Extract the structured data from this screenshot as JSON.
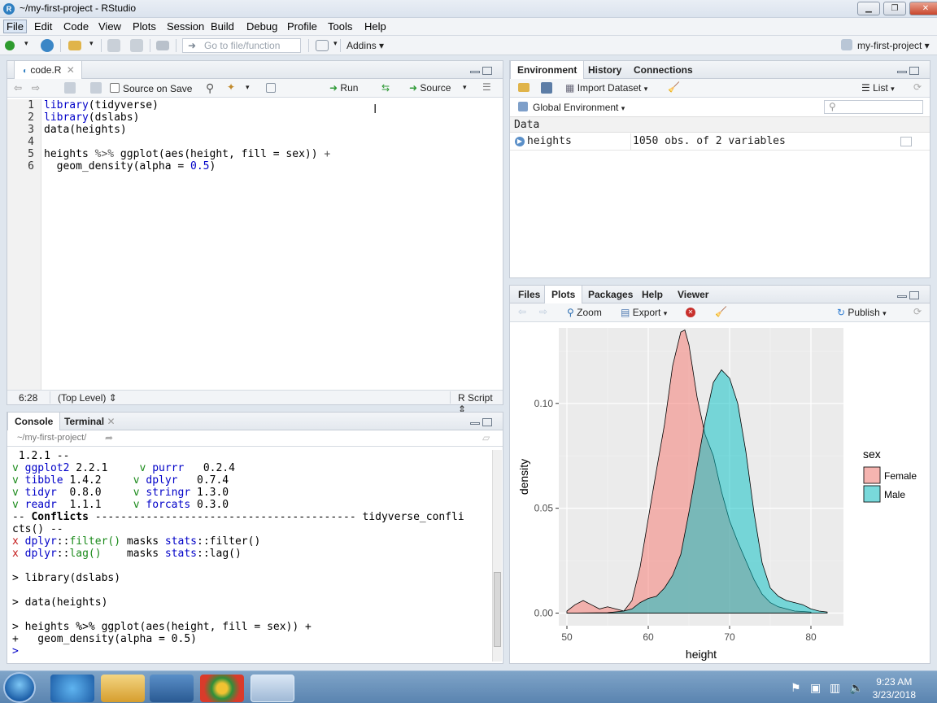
{
  "window": {
    "title": "~/my-first-project - RStudio"
  },
  "menu": [
    "File",
    "Edit",
    "Code",
    "View",
    "Plots",
    "Session",
    "Build",
    "Debug",
    "Profile",
    "Tools",
    "Help"
  ],
  "toolbar": {
    "goto_placeholder": "Go to file/function",
    "addins": "Addins",
    "project": "my-first-project"
  },
  "editor": {
    "tab": "code.R",
    "source_on_save": "Source on Save",
    "run": "Run",
    "source": "Source",
    "lines": [
      {
        "num": "1",
        "parts": [
          [
            "kw",
            "library"
          ],
          [
            "",
            "(tidyverse)"
          ]
        ]
      },
      {
        "num": "2",
        "parts": [
          [
            "kw",
            "library"
          ],
          [
            "",
            "(dslabs)"
          ]
        ]
      },
      {
        "num": "3",
        "parts": [
          [
            "",
            "data(heights)"
          ]
        ]
      },
      {
        "num": "4",
        "parts": [
          [
            "",
            ""
          ]
        ]
      },
      {
        "num": "5",
        "parts": [
          [
            "",
            "heights "
          ],
          [
            "op",
            "%>%"
          ],
          [
            "",
            " ggplot(aes(height, fill = sex)) "
          ],
          [
            "op",
            "+"
          ]
        ]
      },
      {
        "num": "6",
        "parts": [
          [
            "",
            "  geom_density(alpha = "
          ],
          [
            "num",
            "0.5"
          ],
          [
            "",
            ")"
          ]
        ]
      }
    ],
    "status_pos": "6:28",
    "status_scope": "(Top Level)",
    "status_type": "R Script"
  },
  "console": {
    "tabs": [
      "Console",
      "Terminal"
    ],
    "path": "~/my-first-project/",
    "lines": [
      [
        [
          "",
          " 1.2.1 --"
        ]
      ],
      [
        [
          "grn",
          "v "
        ],
        [
          "blu",
          "ggplot2"
        ],
        [
          "",
          " 2.2.1     "
        ],
        [
          "grn",
          "v "
        ],
        [
          "blu",
          "purrr"
        ],
        [
          "",
          "   0.2.4"
        ]
      ],
      [
        [
          "grn",
          "v "
        ],
        [
          "blu",
          "tibble"
        ],
        [
          "",
          " 1.4.2     "
        ],
        [
          "grn",
          "v "
        ],
        [
          "blu",
          "dplyr"
        ],
        [
          "",
          "   0.7.4"
        ]
      ],
      [
        [
          "grn",
          "v "
        ],
        [
          "blu",
          "tidyr"
        ],
        [
          "",
          "  0.8.0     "
        ],
        [
          "grn",
          "v "
        ],
        [
          "blu",
          "stringr"
        ],
        [
          "",
          " 1.3.0"
        ]
      ],
      [
        [
          "grn",
          "v "
        ],
        [
          "blu",
          "readr"
        ],
        [
          "",
          "  1.1.1     "
        ],
        [
          "grn",
          "v "
        ],
        [
          "blu",
          "forcats"
        ],
        [
          "",
          " 0.3.0"
        ]
      ],
      [
        [
          "",
          "-- "
        ],
        [
          "b",
          "Conflicts"
        ],
        [
          "",
          " ----------------------------------------- tidyverse_confli"
        ]
      ],
      [
        [
          "",
          "cts() --"
        ]
      ],
      [
        [
          "red",
          "x "
        ],
        [
          "blu",
          "dplyr"
        ],
        [
          "",
          "::"
        ],
        [
          "grn",
          "filter()"
        ],
        [
          "",
          " masks "
        ],
        [
          "blu",
          "stats"
        ],
        [
          "",
          "::filter()"
        ]
      ],
      [
        [
          "red",
          "x "
        ],
        [
          "blu",
          "dplyr"
        ],
        [
          "",
          "::"
        ],
        [
          "grn",
          "lag()"
        ],
        [
          "",
          "    masks "
        ],
        [
          "blu",
          "stats"
        ],
        [
          "",
          "::lag()"
        ]
      ],
      [
        [
          "",
          ""
        ]
      ],
      [
        [
          "",
          "> library(dslabs)"
        ]
      ],
      [
        [
          "",
          ""
        ]
      ],
      [
        [
          "",
          "> data(heights)"
        ]
      ],
      [
        [
          "",
          ""
        ]
      ],
      [
        [
          "",
          "> heights %>% ggplot(aes(height, fill = sex)) +"
        ]
      ],
      [
        [
          "",
          "+   geom_density(alpha = 0.5)"
        ]
      ],
      [
        [
          "blu",
          "> "
        ]
      ]
    ]
  },
  "environment": {
    "tabs": [
      "Environment",
      "History",
      "Connections"
    ],
    "import_dataset": "Import Dataset",
    "list_view": "List",
    "global_env": "Global Environment",
    "section": "Data",
    "rows": [
      {
        "name": "heights",
        "value": "1050 obs. of 2 variables"
      }
    ]
  },
  "files": {
    "tabs": [
      "Files",
      "Plots",
      "Packages",
      "Help",
      "Viewer"
    ],
    "zoom": "Zoom",
    "export": "Export",
    "publish": "Publish"
  },
  "colors": {
    "female": "#f8766d",
    "male": "#00bfc4",
    "panel_bg": "#ebebeb"
  },
  "chart_data": {
    "type": "area",
    "xlabel": "height",
    "ylabel": "density",
    "xlim": [
      49,
      84
    ],
    "ylim": [
      -0.006,
      0.136
    ],
    "xticks": [
      50,
      60,
      70,
      80
    ],
    "yticks": [
      0.0,
      0.05,
      0.1
    ],
    "ytick_labels": [
      "0.00",
      "0.05",
      "0.10"
    ],
    "legend": {
      "title": "sex",
      "position": "right",
      "entries": [
        "Female",
        "Male"
      ]
    },
    "series": [
      {
        "name": "Female",
        "x": [
          50,
          51,
          52,
          53,
          54,
          55,
          56,
          57,
          58,
          59,
          60,
          61,
          62,
          63,
          64,
          64.5,
          65,
          66,
          67,
          68,
          69,
          70,
          71,
          72,
          73,
          74,
          75,
          76,
          77,
          78,
          79,
          80
        ],
        "y": [
          0.001,
          0.004,
          0.006,
          0.004,
          0.002,
          0.003,
          0.002,
          0.001,
          0.006,
          0.022,
          0.045,
          0.068,
          0.09,
          0.118,
          0.134,
          0.135,
          0.128,
          0.103,
          0.085,
          0.075,
          0.058,
          0.044,
          0.034,
          0.025,
          0.016,
          0.009,
          0.005,
          0.003,
          0.002,
          0.001,
          0.0008,
          0.0005
        ]
      },
      {
        "name": "Male",
        "x": [
          50,
          55,
          57,
          58,
          59,
          60,
          61,
          62,
          63,
          64,
          65,
          66,
          67,
          68,
          69,
          70,
          71,
          72,
          73,
          74,
          75,
          76,
          77,
          78,
          79,
          80,
          81,
          82
        ],
        "y": [
          0.0,
          0.0002,
          0.001,
          0.002,
          0.005,
          0.007,
          0.008,
          0.012,
          0.018,
          0.028,
          0.048,
          0.07,
          0.092,
          0.11,
          0.116,
          0.112,
          0.1,
          0.077,
          0.048,
          0.024,
          0.012,
          0.008,
          0.006,
          0.005,
          0.004,
          0.002,
          0.001,
          0.0005
        ]
      }
    ]
  },
  "taskbar": {
    "time": "9:23 AM",
    "date": "3/23/2018"
  }
}
